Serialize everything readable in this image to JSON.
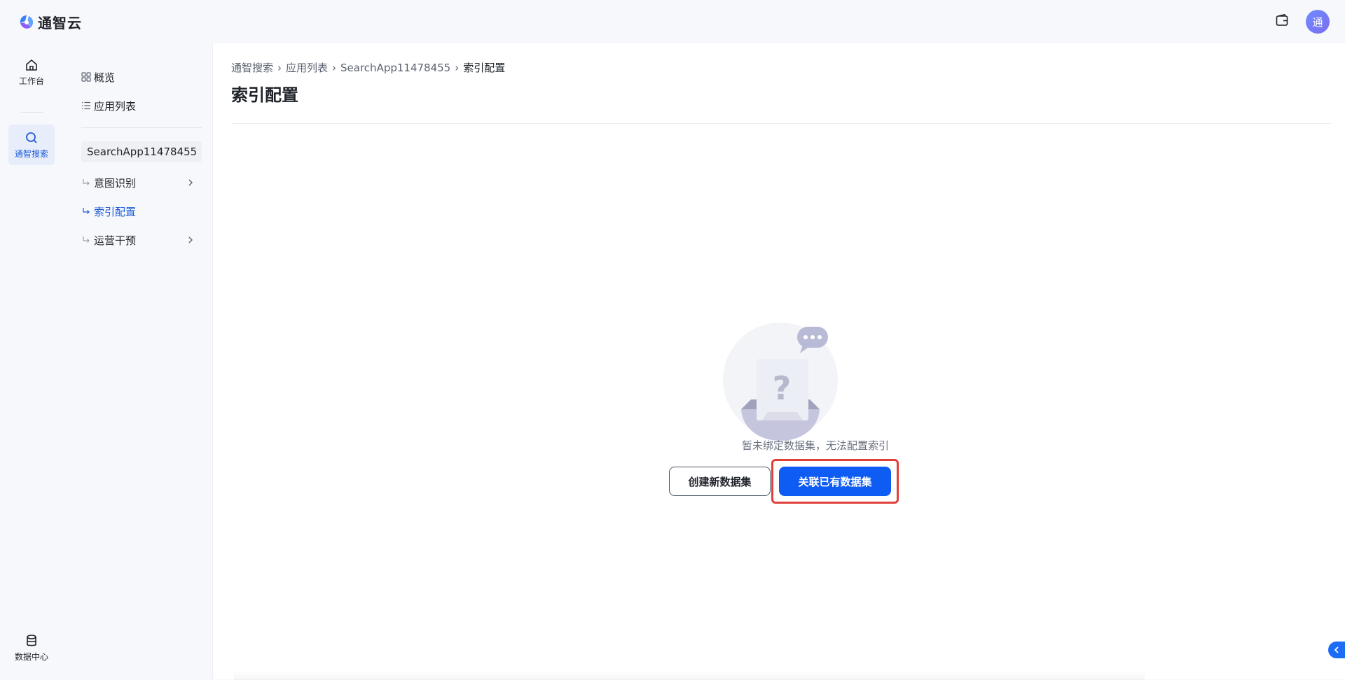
{
  "brand": {
    "name": "通智云"
  },
  "topbar": {
    "avatar_initial": "通"
  },
  "rail": {
    "items": [
      {
        "label": "工作台",
        "icon": "home-icon"
      },
      {
        "label": "通智搜索",
        "icon": "search-icon",
        "active": true
      }
    ],
    "bottom_item": {
      "label": "数据中心",
      "icon": "database-icon"
    }
  },
  "subnav": {
    "overview": "概览",
    "app_list": "应用列表",
    "app_name": "SearchApp11478455",
    "children": [
      {
        "label": "意图识别",
        "expandable": true
      },
      {
        "label": "索引配置",
        "active": true
      },
      {
        "label": "运营干预",
        "expandable": true
      }
    ]
  },
  "breadcrumb": [
    "通智搜索",
    "应用列表",
    "SearchApp11478455",
    "索引配置"
  ],
  "page": {
    "title": "索引配置",
    "empty_message": "暂未绑定数据集，无法配置索引",
    "create_button": "创建新数据集",
    "link_button": "关联已有数据集"
  },
  "colors": {
    "accent": "#0f5cf5",
    "highlight": "#e0403a",
    "active_nav": "#1d5bd8"
  }
}
